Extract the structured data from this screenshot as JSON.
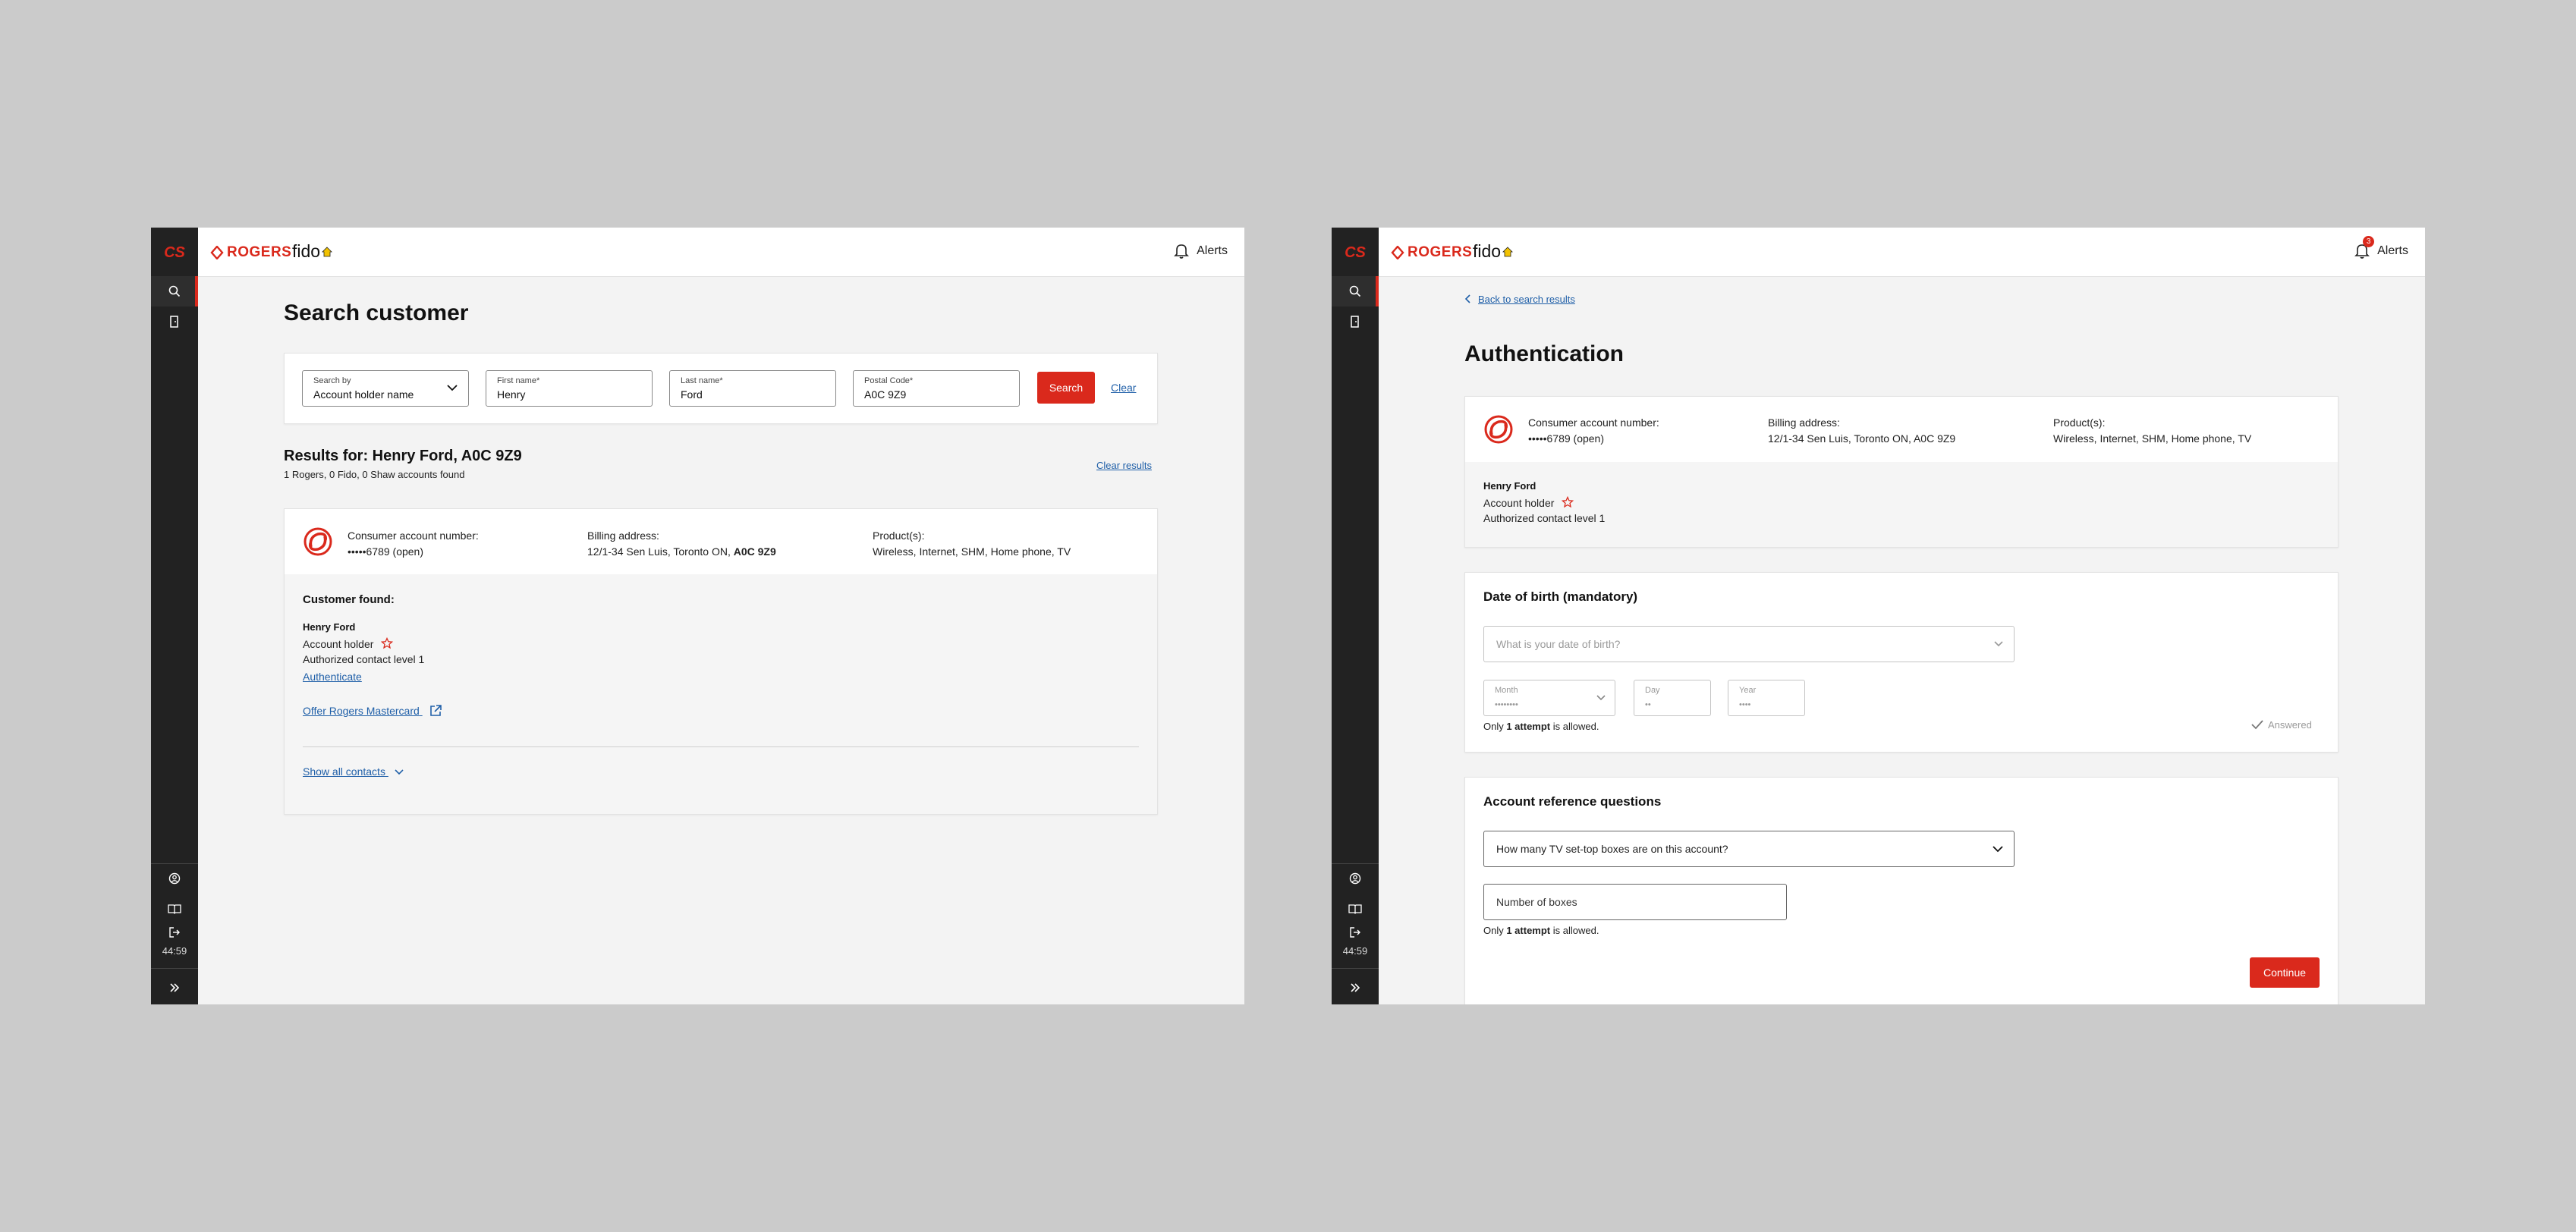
{
  "shared": {
    "rail_logo": "CS",
    "brand_rogers": "ROGERS",
    "brand_fido": "fido",
    "alerts_label": "Alerts",
    "timer": "44:59"
  },
  "left": {
    "title": "Search customer",
    "search": {
      "search_by_label": "Search by",
      "search_by_value": "Account holder name",
      "first_name_label": "First name*",
      "first_name_value": "Henry",
      "last_name_label": "Last name*",
      "last_name_value": "Ford",
      "postal_label": "Postal Code*",
      "postal_value": "A0C 9Z9",
      "search_button": "Search",
      "clear_link": "Clear"
    },
    "results": {
      "heading": "Results for: Henry Ford, A0C 9Z9",
      "summary": "1 Rogers, 0 Fido, 0 Shaw accounts found",
      "clear_results": "Clear results"
    },
    "account": {
      "account_label": "Consumer account number:",
      "account_value": "•••••6789 (open)",
      "billing_label": "Billing address:",
      "billing_value": "12/1-34 Sen Luis, Toronto ON, ",
      "billing_postal": "A0C 9Z9",
      "products_label": "Product(s):",
      "products_value": "Wireless, Internet, SHM, Home phone, TV"
    },
    "customer": {
      "heading": "Customer found:",
      "name": "Henry Ford",
      "role": "Account holder",
      "contact_level": "Authorized contact level 1",
      "authenticate_link": "Authenticate",
      "offer_link": "Offer Rogers Mastercard",
      "show_contacts": "Show all contacts"
    }
  },
  "right": {
    "alert_count": "3",
    "back_link": "Back to search results",
    "title": "Authentication",
    "account": {
      "account_label": "Consumer account number:",
      "account_value": "•••••6789 (open)",
      "billing_label": "Billing address:",
      "billing_value": "12/1-34 Sen Luis, Toronto ON, A0C 9Z9",
      "products_label": "Product(s):",
      "products_value": "Wireless, Internet, SHM, Home phone, TV"
    },
    "contact": {
      "name": "Henry Ford",
      "role": "Account holder",
      "contact_level": "Authorized contact level 1"
    },
    "dob": {
      "heading": "Date of birth (mandatory)",
      "question_placeholder": "What is your date of birth?",
      "month_label": "Month",
      "month_value": "••••••••",
      "day_label": "Day",
      "day_value": "••",
      "year_label": "Year",
      "year_value": "••••",
      "attempt_prefix": "Only ",
      "attempt_bold": "1 attempt",
      "attempt_suffix": " is allowed.",
      "answered": "Answered"
    },
    "account_ref": {
      "heading": "Account reference questions",
      "question": "How many TV set-top boxes are on this account?",
      "answer_placeholder": "Number of boxes",
      "attempt_prefix": "Only ",
      "attempt_bold": "1 attempt",
      "attempt_suffix": " is allowed.",
      "continue_button": "Continue"
    }
  }
}
